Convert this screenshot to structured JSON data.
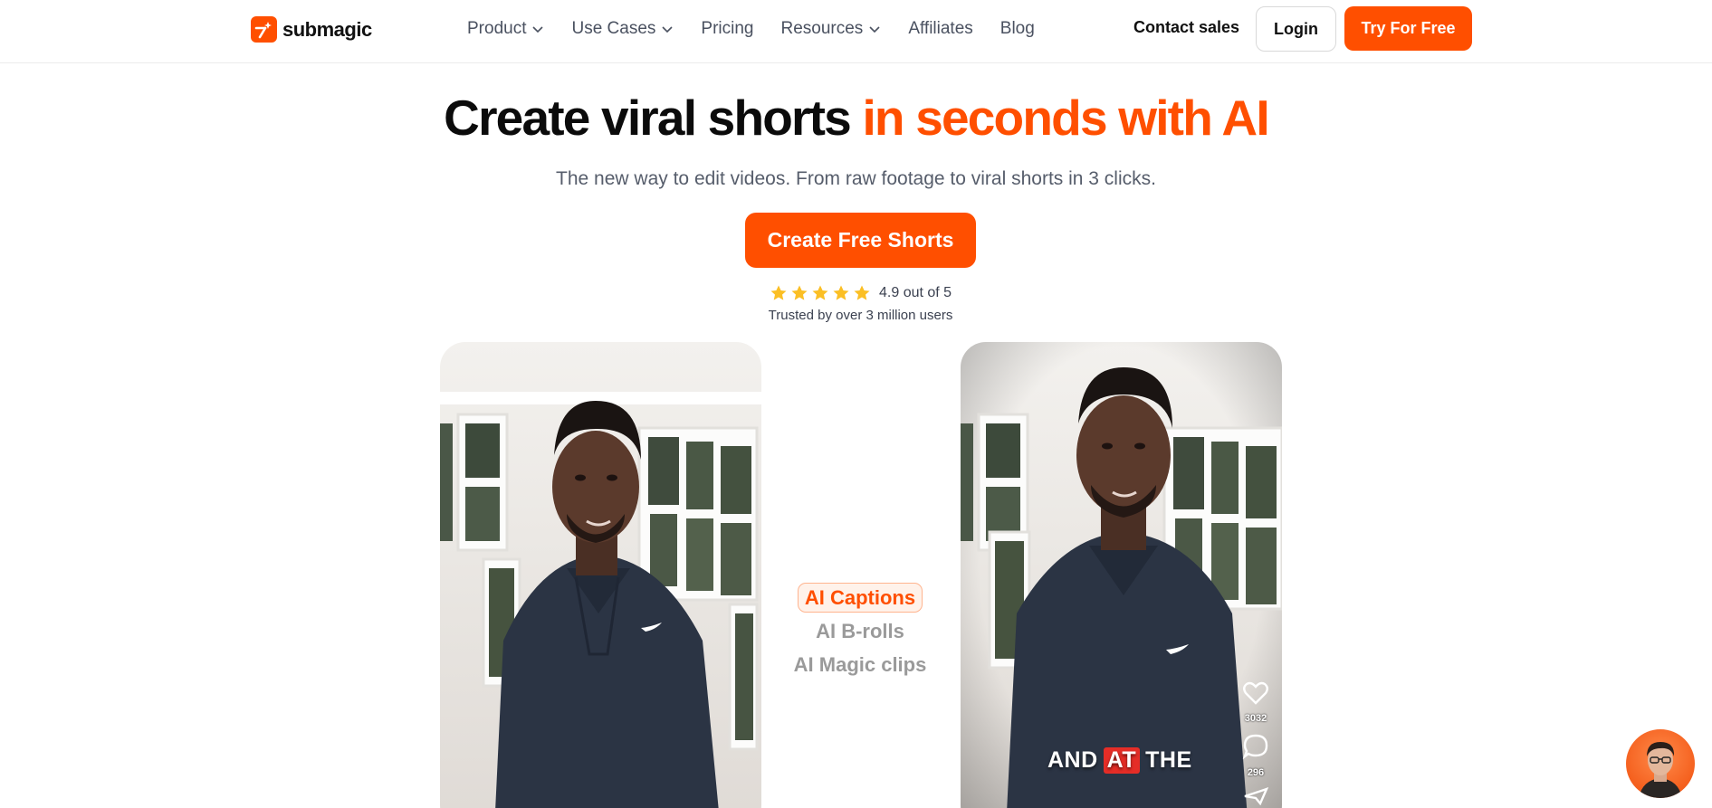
{
  "brand": {
    "name": "submagic",
    "accent_color": "#ff4f00"
  },
  "nav": {
    "items": [
      {
        "label": "Product",
        "dropdown": true
      },
      {
        "label": "Use Cases",
        "dropdown": true
      },
      {
        "label": "Pricing",
        "dropdown": false
      },
      {
        "label": "Resources",
        "dropdown": true
      },
      {
        "label": "Affiliates",
        "dropdown": false
      },
      {
        "label": "Blog",
        "dropdown": false
      }
    ],
    "contact_sales": "Contact sales",
    "login": "Login",
    "try_free": "Try For Free"
  },
  "hero": {
    "title_main": "Create viral shorts ",
    "title_accent": "in seconds with AI",
    "subtitle": "The new way to edit videos. From raw footage to viral shorts in 3 clicks.",
    "cta": "Create Free Shorts",
    "rating": {
      "stars": 5,
      "text": "4.9 out of 5"
    },
    "trusted": "Trusted by over 3 million users"
  },
  "features": {
    "active": "AI Captions",
    "items": [
      "AI B-rolls",
      "AI Magic clips"
    ]
  },
  "video_preview": {
    "likes": "3032",
    "comments": "296",
    "caption_words": [
      "AND",
      "AT",
      "THE"
    ],
    "highlight_word": "AT"
  },
  "icons": [
    "logo-icon",
    "chevron-down-icon",
    "star-icon",
    "heart-icon",
    "comment-icon",
    "share-icon",
    "chat-avatar"
  ]
}
